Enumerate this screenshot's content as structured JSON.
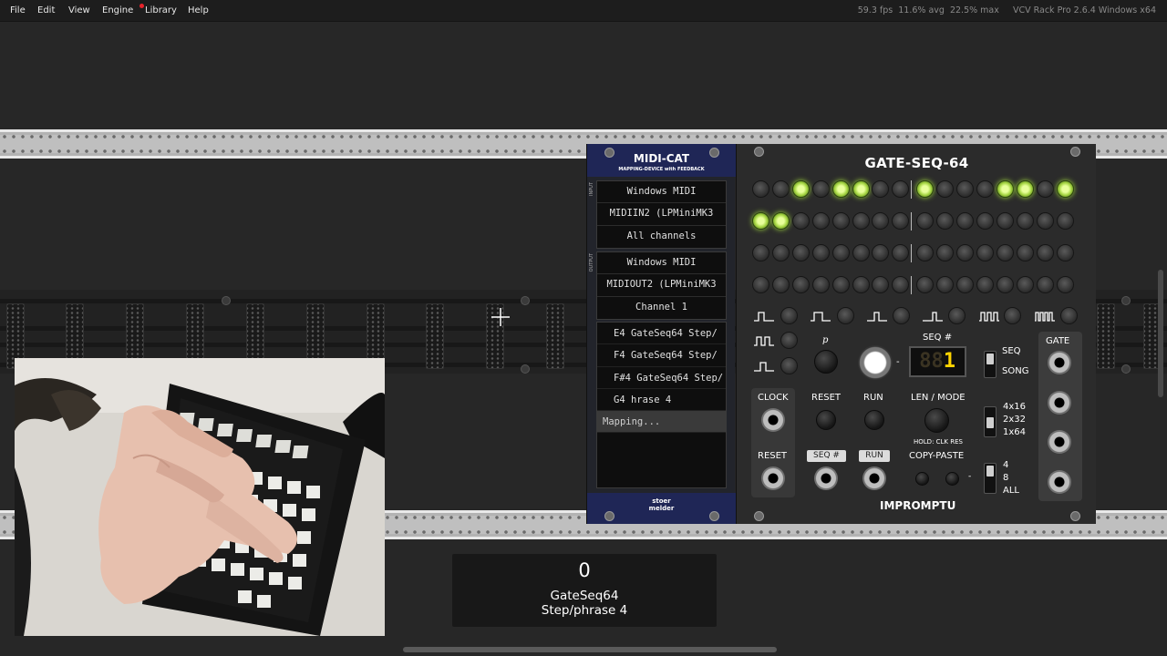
{
  "menubar": {
    "items": [
      "File",
      "Edit",
      "View",
      "Engine",
      "Library",
      "Help"
    ],
    "status": "59.3 fps  11.6% avg  22.5% max     VCV Rack Pro 2.6.4 Windows x64"
  },
  "midicat": {
    "title": "MIDI-CAT",
    "subtitle": "MAPPING-DEVICE with FEEDBACK",
    "input_label": "INPUT",
    "output_label": "OUTPUT",
    "input": [
      "Windows MIDI",
      "MIDIIN2 (LPMiniMK3",
      "All channels"
    ],
    "output": [
      "Windows MIDI",
      "MIDIOUT2 (LPMiniMK3",
      "Channel 1"
    ],
    "mappings": [
      "E4 GateSeq64 Step/",
      "F4 GateSeq64 Step/",
      "F#4 GateSeq64 Step/",
      "G4 hrase 4",
      "Mapping..."
    ],
    "brand_line1": "stoer",
    "brand_line2": "melder"
  },
  "gateseq": {
    "title": "GATE-SEQ-64",
    "rows": [
      [
        0,
        0,
        1,
        0,
        1,
        1,
        0,
        0,
        1,
        0,
        0,
        0,
        1,
        1,
        0,
        1
      ],
      [
        1,
        1,
        0,
        0,
        0,
        0,
        0,
        0,
        0,
        0,
        0,
        0,
        0,
        0,
        0,
        0
      ],
      [
        0,
        0,
        0,
        0,
        0,
        0,
        0,
        0,
        0,
        0,
        0,
        0,
        0,
        0,
        0,
        0
      ],
      [
        0,
        0,
        0,
        0,
        0,
        0,
        0,
        0,
        0,
        0,
        0,
        0,
        0,
        0,
        0,
        0
      ]
    ],
    "p_label": "p",
    "seq_num_label": "SEQ #",
    "seq_display_dim": "88",
    "seq_display_value": "1",
    "seq_label": "SEQ",
    "song_label": "SONG",
    "clock_label": "CLOCK",
    "reset_label": "RESET",
    "run_label": "RUN",
    "len_mode_label": "LEN / MODE",
    "hold_label": "HOLD: CLK RES",
    "reset_in_label": "RESET",
    "seq_tag": "SEQ #",
    "run_tag": "RUN",
    "copy_paste_label": "COPY-PASTE",
    "config": [
      "4x16",
      "2x32",
      "1x64"
    ],
    "copy_opts": [
      "4",
      "8",
      "ALL"
    ],
    "gate_label": "GATE",
    "brand": "IMPROMPTU"
  },
  "osd": {
    "value": "0",
    "param_line1": "GateSeq64",
    "param_line2": "Step/phrase 4"
  },
  "colors": {
    "led_on": "#a8d845",
    "midicat_blue": "#1f2656",
    "seq_display": "#ffd400"
  }
}
